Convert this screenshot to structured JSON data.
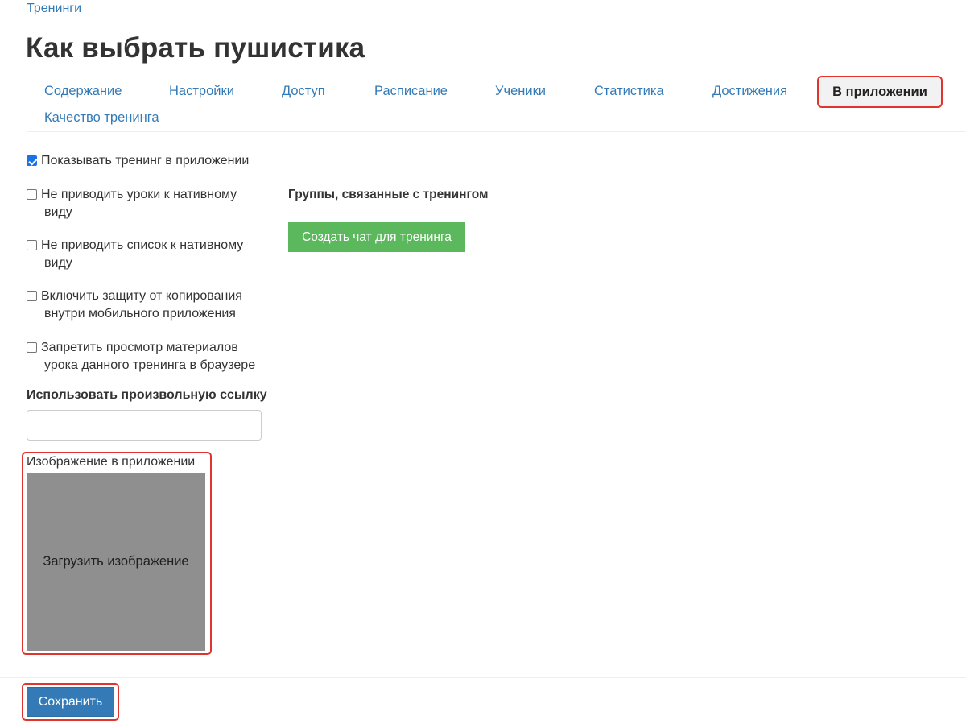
{
  "breadcrumb": {
    "label": "Тренинги"
  },
  "page": {
    "title": "Как выбрать пушистика"
  },
  "tabs": [
    {
      "label": "Содержание"
    },
    {
      "label": "Настройки"
    },
    {
      "label": "Доступ"
    },
    {
      "label": "Расписание"
    },
    {
      "label": "Ученики"
    },
    {
      "label": "Статистика"
    },
    {
      "label": "Достижения"
    },
    {
      "label": "В приложении",
      "active": true
    },
    {
      "label": "Качество тренинга"
    }
  ],
  "settings": {
    "options": [
      {
        "line1": "Показывать тренинг в приложении",
        "line2": "",
        "checked": true
      },
      {
        "line1": "Не приводить уроки к нативному",
        "line2": "виду",
        "checked": false
      },
      {
        "line1": "Не приводить список к нативному",
        "line2": "виду",
        "checked": false
      },
      {
        "line1": "Включить защиту от копирования",
        "line2": "внутри мобильного приложения",
        "checked": false
      },
      {
        "line1": "Запретить просмотр материалов",
        "line2": "урока данного тренинга в браузере",
        "checked": false
      }
    ],
    "custom_link": {
      "label": "Использовать произвольную ссылку",
      "value": "",
      "placeholder": ""
    },
    "app_image": {
      "label": "Изображение в приложении",
      "upload_label": "Загрузить изображение"
    }
  },
  "groups": {
    "title": "Группы, связанные с тренингом",
    "create_chat_label": "Создать чат для тренинга"
  },
  "footer": {
    "save_label": "Сохранить"
  },
  "colors": {
    "link": "#337ab7",
    "highlight": "#e0342f",
    "success": "#5cb85c",
    "primary": "#337ab7",
    "placeholder_bg": "#8f8f8f"
  }
}
